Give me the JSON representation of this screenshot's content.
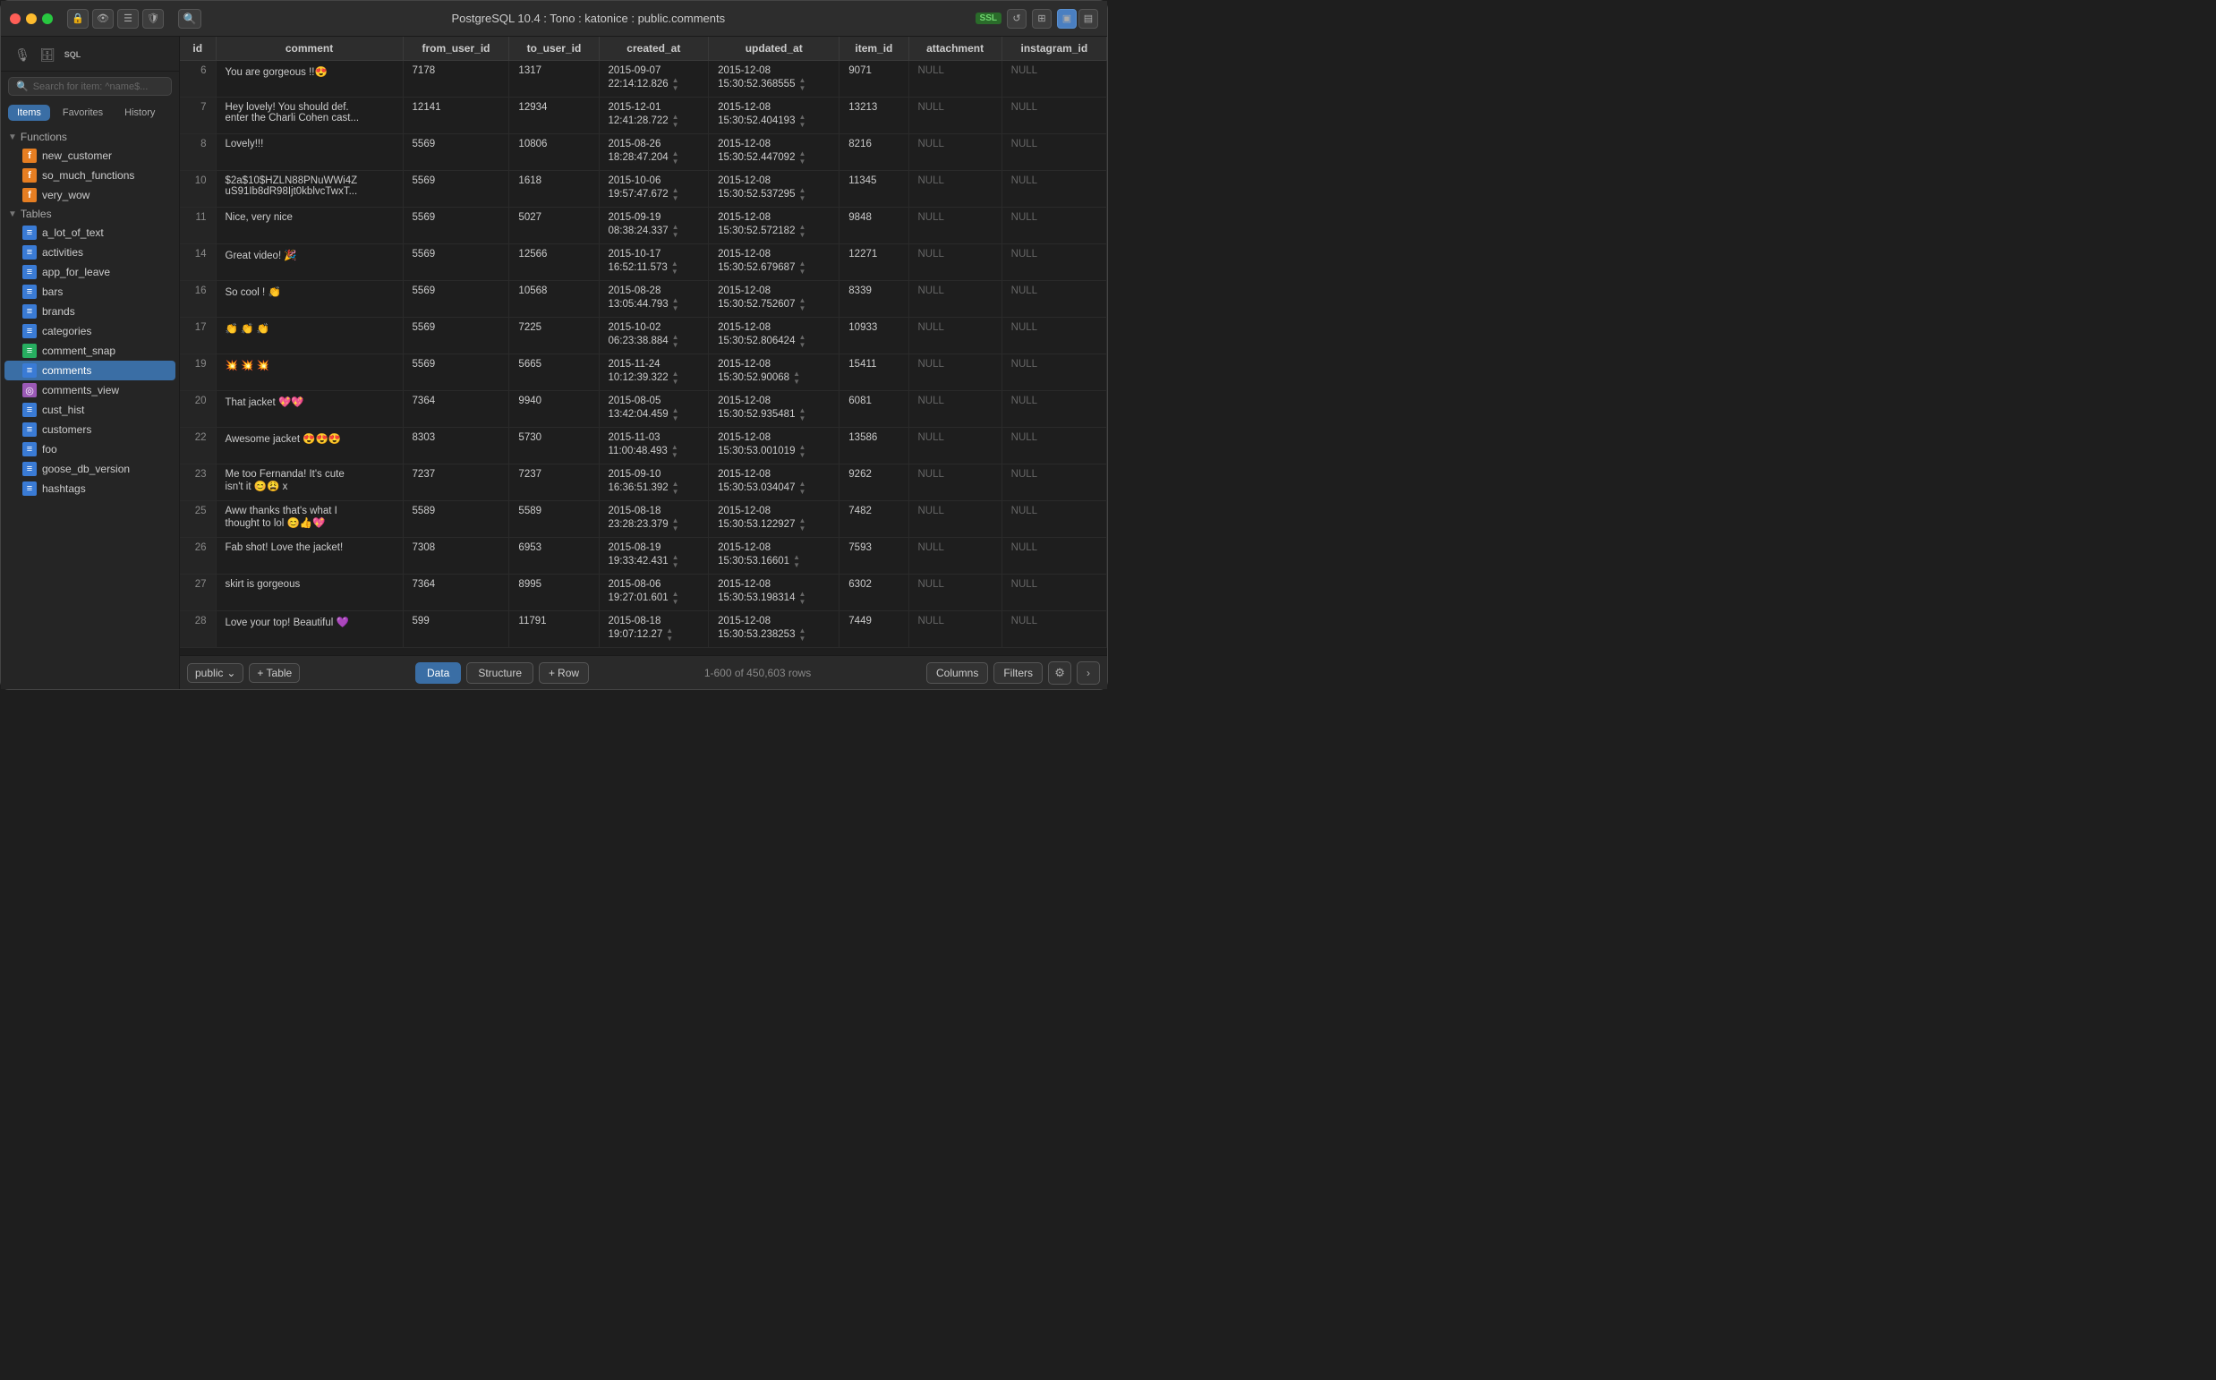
{
  "titlebar": {
    "title": "PostgreSQL 10.4 : Tono : katonice : public.comments",
    "ssl_badge": "SSL",
    "traffic_lights": {
      "close": "close",
      "minimize": "minimize",
      "maximize": "maximize"
    }
  },
  "sidebar": {
    "search_placeholder": "Search for item: ^name$...",
    "tabs": [
      "Items",
      "Favorites",
      "History"
    ],
    "active_tab": "Items",
    "sections": {
      "functions": {
        "label": "Functions",
        "items": [
          {
            "name": "new_customer",
            "type": "func"
          },
          {
            "name": "so_much_functions",
            "type": "func"
          },
          {
            "name": "very_wow",
            "type": "func"
          }
        ]
      },
      "tables": {
        "label": "Tables",
        "items": [
          {
            "name": "a_lot_of_text",
            "type": "table"
          },
          {
            "name": "activities",
            "type": "table"
          },
          {
            "name": "app_for_leave",
            "type": "table"
          },
          {
            "name": "bars",
            "type": "table"
          },
          {
            "name": "brands",
            "type": "table"
          },
          {
            "name": "categories",
            "type": "table"
          },
          {
            "name": "comment_snap",
            "type": "table-alt"
          },
          {
            "name": "comments",
            "type": "table",
            "selected": true
          },
          {
            "name": "comments_view",
            "type": "view"
          },
          {
            "name": "cust_hist",
            "type": "table"
          },
          {
            "name": "customers",
            "type": "table"
          },
          {
            "name": "foo",
            "type": "table"
          },
          {
            "name": "goose_db_version",
            "type": "table"
          },
          {
            "name": "hashtags",
            "type": "table"
          }
        ]
      }
    },
    "schema": "public",
    "add_table_label": "+ Table"
  },
  "table": {
    "columns": [
      "id",
      "comment",
      "from_user_id",
      "to_user_id",
      "created_at",
      "updated_at",
      "item_id",
      "attachment",
      "instagram_id"
    ],
    "rows": [
      {
        "id": "6",
        "comment": "You are gorgeous !!😍",
        "from_user_id": "7178",
        "to_user_id": "1317",
        "created_at": "2015-09-07\n22:14:12.826",
        "updated_at": "2015-12-08\n15:30:52.368555",
        "item_id": "9071",
        "attachment": "NULL",
        "instagram_id": "NULL"
      },
      {
        "id": "7",
        "comment": "Hey lovely! You should def.\nenter the Charli Cohen cast...",
        "from_user_id": "12141",
        "to_user_id": "12934",
        "created_at": "2015-12-01\n12:41:28.722",
        "updated_at": "2015-12-08\n15:30:52.404193",
        "item_id": "13213",
        "attachment": "NULL",
        "instagram_id": "NULL"
      },
      {
        "id": "8",
        "comment": "Lovely!!!",
        "from_user_id": "5569",
        "to_user_id": "10806",
        "created_at": "2015-08-26\n18:28:47.204",
        "updated_at": "2015-12-08\n15:30:52.447092",
        "item_id": "8216",
        "attachment": "NULL",
        "instagram_id": "NULL"
      },
      {
        "id": "10",
        "comment": "$2a$10$HZLN88PNuWWi4Z\nuS91Ib8dR98Ijt0kblvcTwxT...",
        "from_user_id": "5569",
        "to_user_id": "1618",
        "created_at": "2015-10-06\n19:57:47.672",
        "updated_at": "2015-12-08\n15:30:52.537295",
        "item_id": "11345",
        "attachment": "NULL",
        "instagram_id": "NULL"
      },
      {
        "id": "11",
        "comment": "Nice, very nice",
        "from_user_id": "5569",
        "to_user_id": "5027",
        "created_at": "2015-09-19\n08:38:24.337",
        "updated_at": "2015-12-08\n15:30:52.572182",
        "item_id": "9848",
        "attachment": "NULL",
        "instagram_id": "NULL"
      },
      {
        "id": "14",
        "comment": "Great video! 🎉",
        "from_user_id": "5569",
        "to_user_id": "12566",
        "created_at": "2015-10-17\n16:52:11.573",
        "updated_at": "2015-12-08\n15:30:52.679687",
        "item_id": "12271",
        "attachment": "NULL",
        "instagram_id": "NULL"
      },
      {
        "id": "16",
        "comment": "So cool ! 👏",
        "from_user_id": "5569",
        "to_user_id": "10568",
        "created_at": "2015-08-28\n13:05:44.793",
        "updated_at": "2015-12-08\n15:30:52.752607",
        "item_id": "8339",
        "attachment": "NULL",
        "instagram_id": "NULL"
      },
      {
        "id": "17",
        "comment": "👏 👏 👏",
        "from_user_id": "5569",
        "to_user_id": "7225",
        "created_at": "2015-10-02\n06:23:38.884",
        "updated_at": "2015-12-08\n15:30:52.806424",
        "item_id": "10933",
        "attachment": "NULL",
        "instagram_id": "NULL"
      },
      {
        "id": "19",
        "comment": "💥 💥 💥",
        "from_user_id": "5569",
        "to_user_id": "5665",
        "created_at": "2015-11-24\n10:12:39.322",
        "updated_at": "2015-12-08\n15:30:52.90068",
        "item_id": "15411",
        "attachment": "NULL",
        "instagram_id": "NULL"
      },
      {
        "id": "20",
        "comment": "That jacket 💖💖",
        "from_user_id": "7364",
        "to_user_id": "9940",
        "created_at": "2015-08-05\n13:42:04.459",
        "updated_at": "2015-12-08\n15:30:52.935481",
        "item_id": "6081",
        "attachment": "NULL",
        "instagram_id": "NULL"
      },
      {
        "id": "22",
        "comment": "Awesome jacket 😍😍😍",
        "from_user_id": "8303",
        "to_user_id": "5730",
        "created_at": "2015-11-03\n11:00:48.493",
        "updated_at": "2015-12-08\n15:30:53.001019",
        "item_id": "13586",
        "attachment": "NULL",
        "instagram_id": "NULL"
      },
      {
        "id": "23",
        "comment": "Me too Fernanda! It's cute\nisn't it 😊😩 x",
        "from_user_id": "7237",
        "to_user_id": "7237",
        "created_at": "2015-09-10\n16:36:51.392",
        "updated_at": "2015-12-08\n15:30:53.034047",
        "item_id": "9262",
        "attachment": "NULL",
        "instagram_id": "NULL"
      },
      {
        "id": "25",
        "comment": "Aww thanks that's what I\nthought to lol 😊👍💖",
        "from_user_id": "5589",
        "to_user_id": "5589",
        "created_at": "2015-08-18\n23:28:23.379",
        "updated_at": "2015-12-08\n15:30:53.122927",
        "item_id": "7482",
        "attachment": "NULL",
        "instagram_id": "NULL"
      },
      {
        "id": "26",
        "comment": "Fab shot! Love the jacket!",
        "from_user_id": "7308",
        "to_user_id": "6953",
        "created_at": "2015-08-19\n19:33:42.431",
        "updated_at": "2015-12-08\n15:30:53.16601",
        "item_id": "7593",
        "attachment": "NULL",
        "instagram_id": "NULL"
      },
      {
        "id": "27",
        "comment": "skirt is gorgeous",
        "from_user_id": "7364",
        "to_user_id": "8995",
        "created_at": "2015-08-06\n19:27:01.601",
        "updated_at": "2015-12-08\n15:30:53.198314",
        "item_id": "6302",
        "attachment": "NULL",
        "instagram_id": "NULL"
      },
      {
        "id": "28",
        "comment": "Love your top! Beautiful 💜",
        "from_user_id": "599",
        "to_user_id": "11791",
        "created_at": "2015-08-18\n19:07:12.27",
        "updated_at": "2015-12-08\n15:30:53.238253",
        "item_id": "7449",
        "attachment": "NULL",
        "instagram_id": "NULL"
      }
    ]
  },
  "bottom_bar": {
    "schema": "public",
    "add_table": "+ Table",
    "tabs": [
      "Data",
      "Structure"
    ],
    "active_tab": "Data",
    "add_row": "+ Row",
    "rows_info": "1-600 of 450,603 rows",
    "columns_btn": "Columns",
    "filters_btn": "Filters"
  }
}
